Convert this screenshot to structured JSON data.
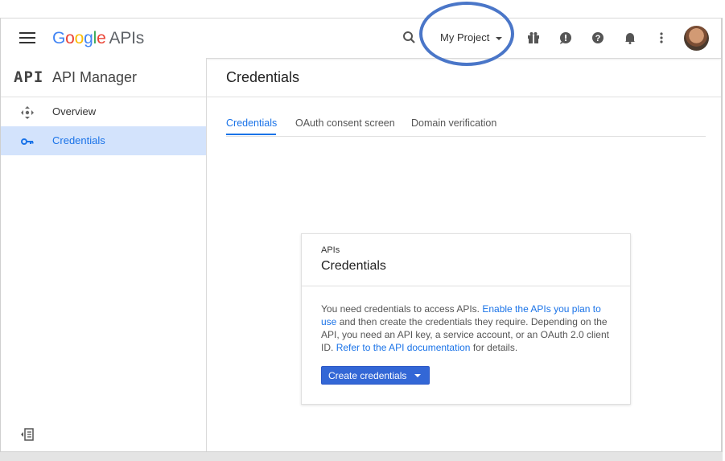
{
  "header": {
    "logo": {
      "google": [
        "G",
        "o",
        "o",
        "g",
        "l",
        "e"
      ],
      "product": "APIs"
    },
    "project_label": "My Project",
    "icons": [
      "search-icon",
      "gift-icon",
      "feedback-icon",
      "help-icon",
      "notifications-icon",
      "more-vert-icon"
    ],
    "accent": "#4a76c8"
  },
  "sidebar": {
    "badge": "API",
    "title": "API Manager",
    "items": [
      {
        "label": "Overview",
        "icon": "overview-icon",
        "active": false
      },
      {
        "label": "Credentials",
        "icon": "key-icon",
        "active": true
      }
    ]
  },
  "main": {
    "title": "Credentials",
    "tabs": [
      {
        "label": "Credentials",
        "active": true
      },
      {
        "label": "OAuth consent screen",
        "active": false
      },
      {
        "label": "Domain verification",
        "active": false
      }
    ],
    "card": {
      "overline": "APIs",
      "title": "Credentials",
      "text1": "You need credentials to access APIs.",
      "link1": "Enable the APIs you plan to use",
      "text2": "and then create the credentials they require. Depending on the API, you need an API key, a service account, or an OAuth 2.0 client ID.",
      "link2": "Refer to the API documentation",
      "text3": "for details.",
      "button": "Create credentials"
    }
  },
  "colors": {
    "primary": "#1a73e8",
    "button": "#3367d6",
    "active_nav": "#d3e3fc"
  }
}
